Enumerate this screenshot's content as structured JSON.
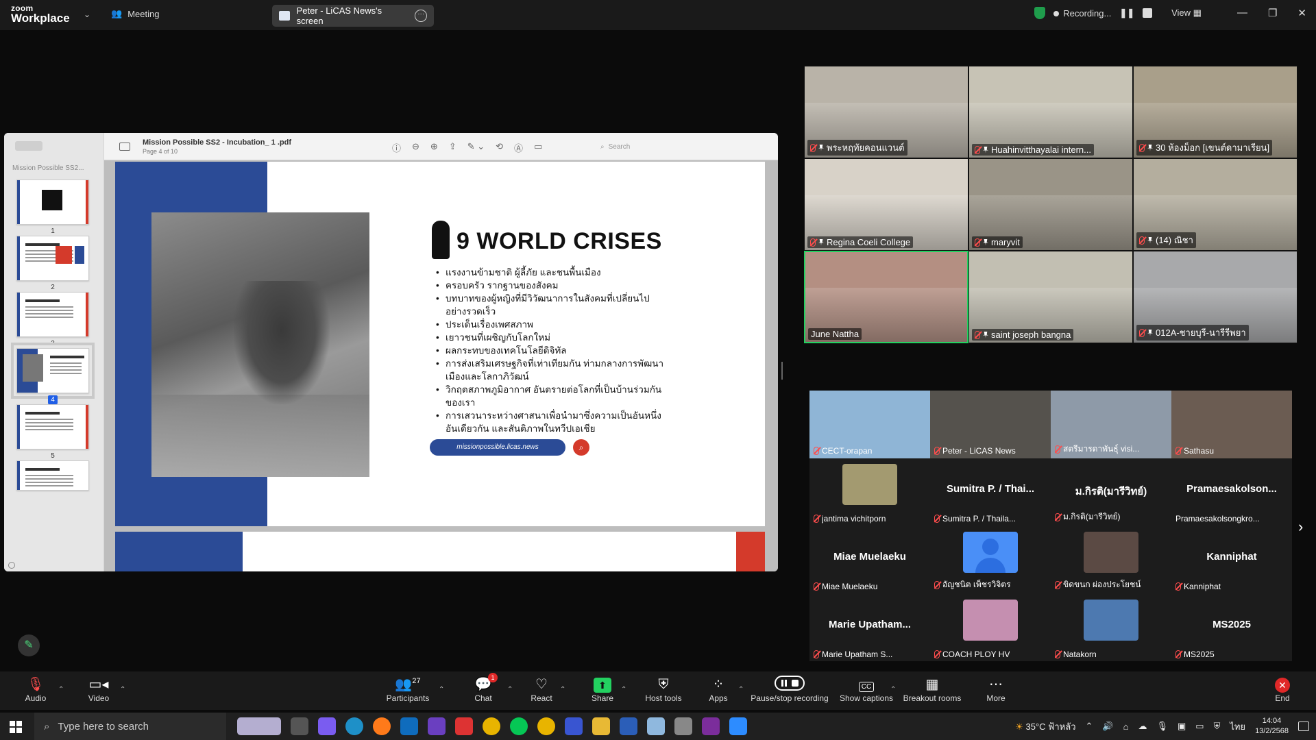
{
  "app": {
    "brand_top": "zoom",
    "brand_bottom": "Workplace",
    "meeting_label": "Meeting"
  },
  "screen_share": {
    "label": "Peter - LiCAS News's screen"
  },
  "recording": {
    "label": "Recording...",
    "view_label": "View"
  },
  "pdf": {
    "title": "Mission Possible SS2 - Incubation_ 1 .pdf",
    "page_info": "Page 4 of 10",
    "search_placeholder": "Search",
    "sidebar_title": "Mission Possible SS2...",
    "thumbnails": [
      {
        "num": "1"
      },
      {
        "num": "2"
      },
      {
        "num": "3"
      },
      {
        "num": "4"
      },
      {
        "num": "5"
      },
      {
        "num": ""
      }
    ],
    "selected_page": "4"
  },
  "slide": {
    "title": "9 WORLD CRISES",
    "bullets": [
      "แรงงานข้ามชาติ ผู้ลี้ภัย และชนพื้นเมือง",
      "ครอบครัว รากฐานของสังคม",
      "บทบาทของผู้หญิงที่มีวิวัฒนาการในสังคมที่เปลี่ยนไปอย่างรวดเร็ว",
      "ประเด็นเรื่องเพศสภาพ",
      "เยาวชนที่เผชิญกับโลกใหม่",
      "ผลกระทบของเทคโนโลยีดิจิทัล",
      "การส่งเสริมเศรษฐกิจที่เท่าเทียมกัน ท่ามกลางการพัฒนาเมืองและโลกาภิวัฒน์",
      "วิกฤตสภาพภูมิอากาศ อันตรายต่อโลกที่เป็นบ้านร่วมกันของเรา",
      "การเสวนาระหว่างศาสนาเพื่อนำมาซึ่งความเป็นอันหนึ่งอันเดียวกัน และสันติภาพในทวีปเอเชีย"
    ],
    "link": "missionpossible.licas.news"
  },
  "video_grid_top": [
    {
      "name": "พระหฤทัยคอนแวนต์",
      "bg": "#b9b3a8"
    },
    {
      "name": "Huahinvitthayalai intern...",
      "bg": "#c7c3b5"
    },
    {
      "name": "30 ห้องม็อก [เขนต์ดามาเรียน]",
      "bg": "#a99f8a"
    },
    {
      "name": "Regina Coeli College",
      "bg": "#d8d2c8"
    },
    {
      "name": "maryvit",
      "bg": "#9a9487"
    },
    {
      "name": "(14) ณิชา",
      "bg": "#b4ae9e"
    },
    {
      "name": "June Nattha",
      "bg": "#b48f82",
      "active": true
    },
    {
      "name": "saint joseph bangna",
      "bg": "#c2bfb2"
    },
    {
      "name": "012A-ชายบุรี-นารีรีพยา",
      "bg": "#a8a9ab"
    }
  ],
  "video_grid_bottom": [
    {
      "display": "",
      "name": "CECT-orapan",
      "type": "video",
      "bg": "#8fb5d6"
    },
    {
      "display": "",
      "name": "Peter - LiCAS News",
      "type": "video",
      "bg": "#55524d"
    },
    {
      "display": "",
      "name": "สตรีมารดาพันธุ์ visi...",
      "type": "video",
      "bg": "#8e9aa8"
    },
    {
      "display": "",
      "name": "Sathasu",
      "type": "video",
      "bg": "#6b5c52"
    },
    {
      "display": "",
      "name": "jantima vichitporn",
      "type": "thumb",
      "bg": "#a39a70"
    },
    {
      "display": "Sumitra P. / Thai...",
      "name": "Sumitra P. / Thaila...",
      "type": "name"
    },
    {
      "display": "ม.กิรติ(มารีวิทย์)",
      "name": "ม.กิรติ(มารีวิทย์)",
      "type": "name"
    },
    {
      "display": "Pramaesakolson...",
      "name": "Pramaesakolsongkro...",
      "type": "name"
    },
    {
      "display": "Miae Muelaeku",
      "name": "Miae Muelaeku",
      "type": "name"
    },
    {
      "display": "",
      "name": "อัญชนิต เพ็ชรวิจิตร",
      "type": "avatar"
    },
    {
      "display": "",
      "name": "ขิดขนก ผ่องประโยชน์",
      "type": "thumb",
      "bg": "#5b4a44"
    },
    {
      "display": "Kanniphat",
      "name": "Kanniphat",
      "type": "name"
    },
    {
      "display": "Marie Upatham...",
      "name": "Marie Upatham S...",
      "type": "name"
    },
    {
      "display": "",
      "name": "COACH PLOY HV",
      "type": "thumb",
      "bg": "#c58fb0"
    },
    {
      "display": "",
      "name": "Natakorn",
      "type": "thumb",
      "bg": "#4d79b0"
    },
    {
      "display": "MS2025",
      "name": "MS2025",
      "type": "name"
    }
  ],
  "toolbar": {
    "audio": "Audio",
    "video": "Video",
    "participants": "Participants",
    "participants_count": "27",
    "chat": "Chat",
    "chat_badge": "1",
    "react": "React",
    "share": "Share",
    "host_tools": "Host tools",
    "apps": "Apps",
    "pause_rec": "Pause/stop recording",
    "captions": "Show captions",
    "breakout": "Breakout rooms",
    "more": "More",
    "end": "End"
  },
  "taskbar": {
    "search_placeholder": "Type here to search",
    "weather": "35°C ฟ้าหลัว",
    "lang": "ไทย",
    "time": "14:04",
    "date": "13/2/2568"
  },
  "colors": {
    "accent_green": "#23d160",
    "slide_blue": "#2b4b96",
    "slide_red": "#d43a2b",
    "end_red": "#e02828"
  }
}
